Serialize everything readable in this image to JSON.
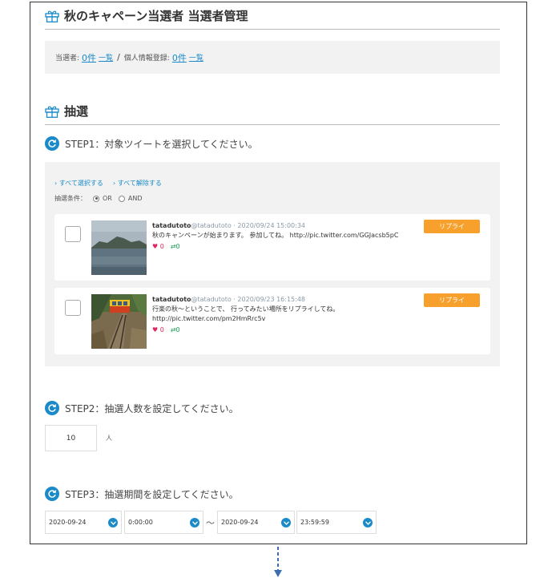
{
  "header": {
    "title": "秋のキャペーン当選者 当選者管理"
  },
  "summary": {
    "winners_label": "当選者:",
    "winners_count": "0件",
    "winners_link": "一覧",
    "separator": "/",
    "registered_label": "個人情報登録:",
    "registered_count": "0件",
    "registered_link": "一覧"
  },
  "lottery": {
    "title": "抽選"
  },
  "step1": {
    "label": "STEP1：対象ツイートを選択してください。",
    "select_all": "› すべて選択する",
    "deselect_all": "› すべて解除する",
    "condition_label": "抽選条件：",
    "options": [
      "OR",
      "AND"
    ],
    "selected_option": "OR"
  },
  "tweets": [
    {
      "user": "tatadutoto",
      "meta": "@tatadutoto · 2020/09/24 15:00:34",
      "text_lines": [
        "秋のキャンペーンが始まります。 参加してね。 http://pic.twitter.com/GGJacsb5pC"
      ],
      "likes": "0",
      "retweets": "0",
      "button": "リプライ",
      "thumbnail": "lake-mountain-photo"
    },
    {
      "user": "tatadutoto",
      "meta": "@tatadutoto · 2020/09/23 16:15:48",
      "text_lines": [
        "行楽の秋〜ということで、 行ってみたい場所をリプライしてね。",
        "http://pic.twitter.com/pm2HmRrc5v"
      ],
      "likes": "0",
      "retweets": "0",
      "button": "リプライ",
      "thumbnail": "railway-photo"
    }
  ],
  "step2": {
    "label": "STEP2：抽選人数を設定してください。",
    "value": "10",
    "unit": "人"
  },
  "step3": {
    "label": "STEP3：抽選期間を設定してください。",
    "start_date": "2020-09-24",
    "start_time": "0:00:00",
    "tilde": "〜",
    "end_date": "2020-09-24",
    "end_time": "23:59:59"
  },
  "colors": {
    "accent": "#1a8ac9",
    "reply": "#f7a02c",
    "panel": "#f2f2f2"
  }
}
